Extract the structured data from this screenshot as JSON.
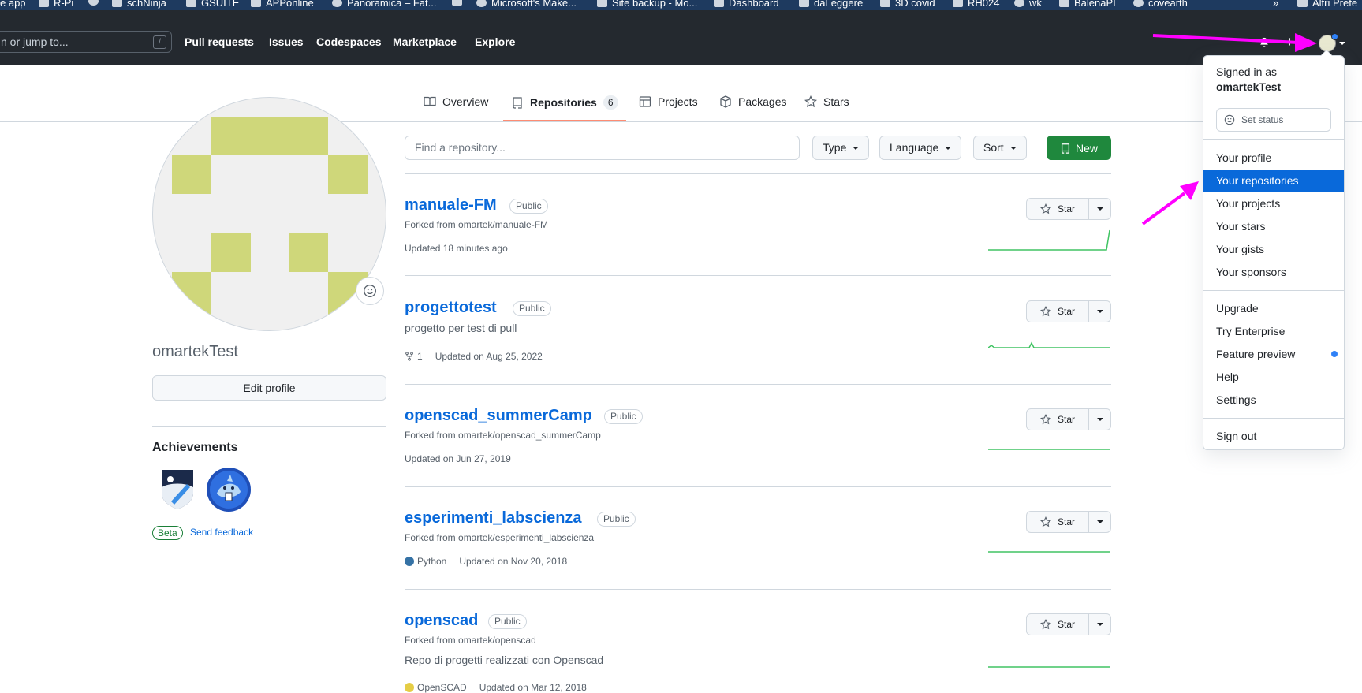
{
  "bookmarks": [
    {
      "label": "e app",
      "icon": "app-icon"
    },
    {
      "label": "R-Pi",
      "icon": "slack-icon"
    },
    {
      "label": "",
      "icon": "github-icon"
    },
    {
      "label": "schNinja",
      "icon": "slack-icon"
    },
    {
      "label": "GSUITE",
      "icon": "folder-icon"
    },
    {
      "label": "APPonline",
      "icon": "folder-icon"
    },
    {
      "label": "Panoramica – Fat...",
      "icon": "site-icon"
    },
    {
      "label": "",
      "icon": "slack-icon"
    },
    {
      "label": "Microsoft's Make...",
      "icon": "google-icon"
    },
    {
      "label": "Site backup - Mo...",
      "icon": "site-icon"
    },
    {
      "label": "Dashboard",
      "icon": "dashboard-icon"
    },
    {
      "label": "daLeggere",
      "icon": "folder-icon"
    },
    {
      "label": "3D covid",
      "icon": "folder-icon"
    },
    {
      "label": "RH024",
      "icon": "folder-icon"
    },
    {
      "label": "wk",
      "icon": "wiki-icon"
    },
    {
      "label": "BalenaPI",
      "icon": "balena-icon"
    },
    {
      "label": "covearth",
      "icon": "site-icon"
    },
    {
      "label": "»",
      "icon": ""
    },
    {
      "label": "Altri Prefe",
      "icon": "folder-icon"
    }
  ],
  "header": {
    "search_placeholder": "n or jump to...",
    "search_shortcut": "/",
    "nav": [
      "Pull requests",
      "Issues",
      "Codespaces",
      "Marketplace",
      "Explore"
    ],
    "plus": "+"
  },
  "tabs": [
    {
      "label": "Overview",
      "icon": "book-icon"
    },
    {
      "label": "Repositories",
      "icon": "repo-icon",
      "count": "6"
    },
    {
      "label": "Projects",
      "icon": "table-icon"
    },
    {
      "label": "Packages",
      "icon": "package-icon"
    },
    {
      "label": "Stars",
      "icon": "star-icon"
    }
  ],
  "profile": {
    "username": "omartekTest",
    "edit_label": "Edit profile",
    "achievements_title": "Achievements",
    "beta_label": "Beta",
    "feedback_label": "Send feedback"
  },
  "controls": {
    "find_placeholder": "Find a repository...",
    "type_label": "Type",
    "language_label": "Language",
    "sort_label": "Sort",
    "new_label": "New"
  },
  "repos": [
    {
      "name": "manuale-FM",
      "visibility": "Public",
      "forked": "Forked from omartek/manuale-FM",
      "desc": "",
      "language": "",
      "forks": "",
      "updated": "Updated 18 minutes ago",
      "star": "Star"
    },
    {
      "name": "progettotest",
      "visibility": "Public",
      "forked": "",
      "desc": "progetto per test di pull",
      "language": "",
      "forks": "1",
      "updated": "Updated on Aug 25, 2022",
      "star": "Star"
    },
    {
      "name": "openscad_summerCamp",
      "visibility": "Public",
      "forked": "Forked from omartek/openscad_summerCamp",
      "desc": "",
      "language": "",
      "forks": "",
      "updated": "Updated on Jun 27, 2019",
      "star": "Star"
    },
    {
      "name": "esperimenti_labscienza",
      "visibility": "Public",
      "forked": "Forked from omartek/esperimenti_labscienza",
      "desc": "",
      "language": "Python",
      "forks": "",
      "updated": "Updated on Nov 20, 2018",
      "star": "Star"
    },
    {
      "name": "openscad",
      "visibility": "Public",
      "forked": "Forked from omartek/openscad",
      "desc": "Repo di progetti realizzati con Openscad",
      "language": "OpenSCAD",
      "forks": "",
      "updated": "Updated on Mar 12, 2018",
      "star": "Star"
    }
  ],
  "colors": {
    "python": "#3572A5",
    "openscad": "#e5cd45",
    "accent_green": "#1f883d",
    "link_blue": "#0969da",
    "annotation_magenta": "#ff00ff",
    "identicon": "#cfd77a"
  },
  "dropdown": {
    "signed_in_as": "Signed in as",
    "user": "omartekTest",
    "set_status": "Set status",
    "group1": [
      "Your profile",
      "Your repositories",
      "Your projects",
      "Your stars",
      "Your gists",
      "Your sponsors"
    ],
    "group2": [
      "Upgrade",
      "Try Enterprise",
      "Feature preview",
      "Help",
      "Settings"
    ],
    "sign_out": "Sign out",
    "active_item": "Your repositories"
  }
}
